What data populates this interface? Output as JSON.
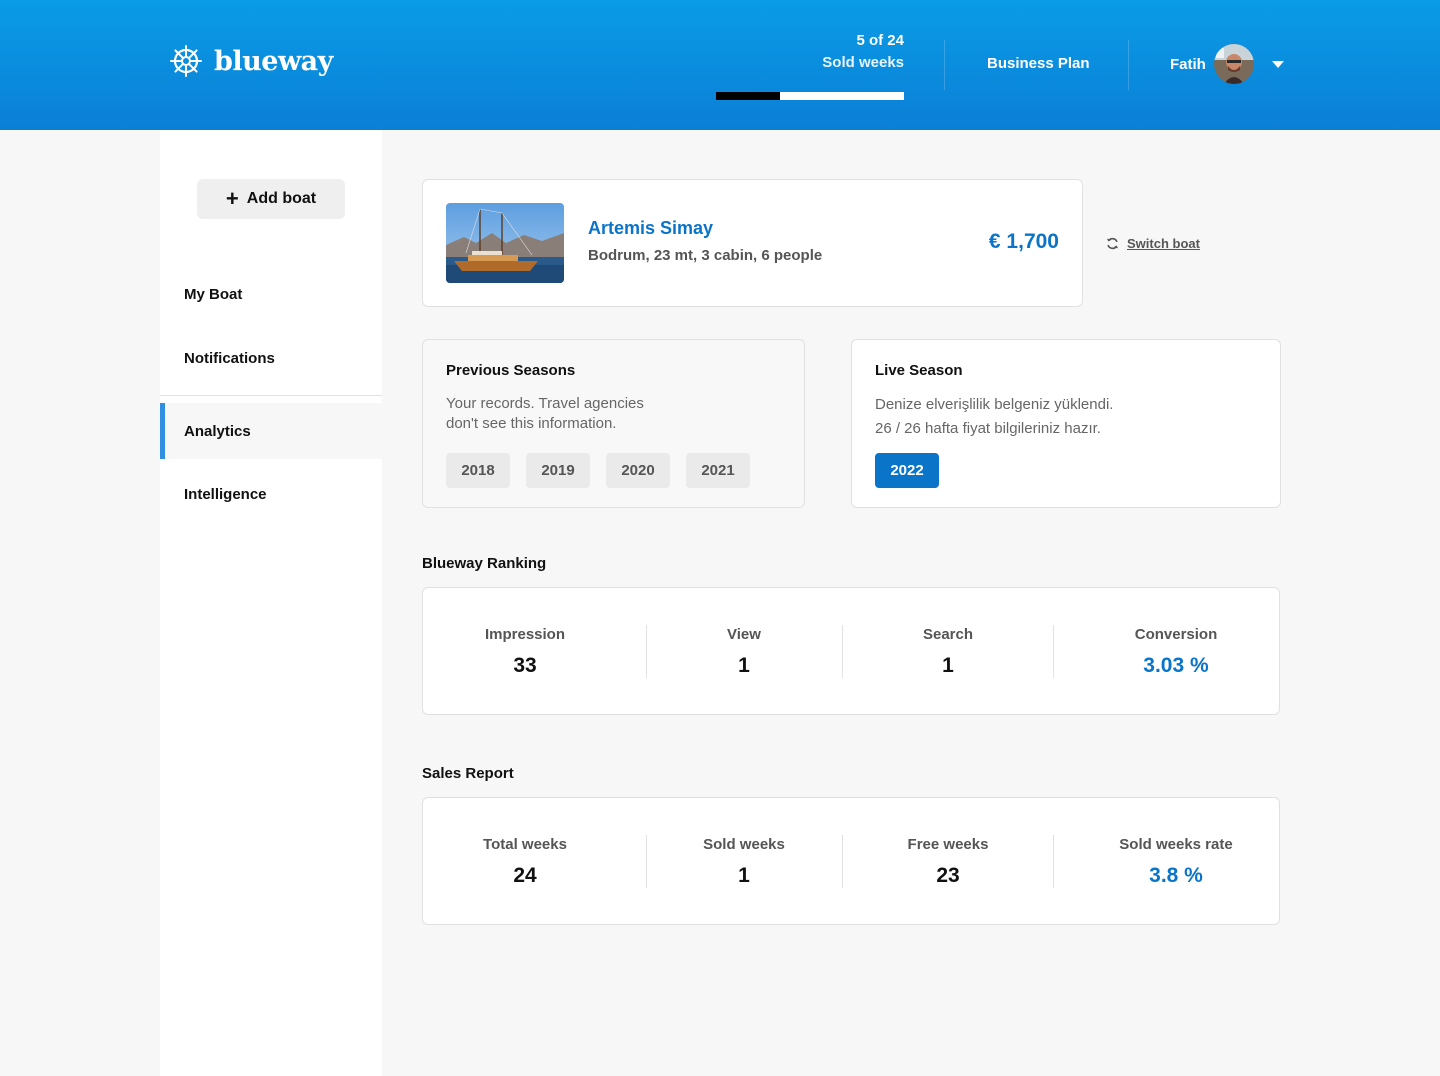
{
  "header": {
    "logo_text": "blueway",
    "sold_count": "5 of 24",
    "sold_label": "Sold weeks",
    "sold_progress": 0.34,
    "business_plan": "Business Plan",
    "user_name": "Fatih"
  },
  "sidebar": {
    "add_boat": "Add boat",
    "items": [
      {
        "label": "My Boat"
      },
      {
        "label": "Notifications"
      },
      {
        "label": "Analytics"
      },
      {
        "label": "Intelligence"
      }
    ],
    "active_item": "Analytics"
  },
  "boat": {
    "name": "Artemis Simay",
    "description": "Bodrum, 23 mt, 3 cabin, 6 people",
    "price": "€ 1,700",
    "switch_label": "Switch boat"
  },
  "previous_seasons": {
    "title": "Previous Seasons",
    "line1": "Your records. Travel agencies",
    "line2": "don't see this information.",
    "years": [
      "2018",
      "2019",
      "2020",
      "2021"
    ]
  },
  "live_season": {
    "title": "Live Season",
    "line1": "Denize elverişlilik belgeniz yüklendi.",
    "line2": "26 / 26 hafta fiyat bilgileriniz hazır.",
    "year": "2022"
  },
  "ranking": {
    "title": "Blueway Ranking",
    "stats": [
      {
        "label": "Impression",
        "value": "33"
      },
      {
        "label": "View",
        "value": "1"
      },
      {
        "label": "Search",
        "value": "1"
      },
      {
        "label": "Conversion",
        "value": "3.03 %"
      }
    ]
  },
  "sales": {
    "title": "Sales Report",
    "stats": [
      {
        "label": "Total weeks",
        "value": "24"
      },
      {
        "label": "Sold weeks",
        "value": "1"
      },
      {
        "label": "Free weeks",
        "value": "23"
      },
      {
        "label": "Sold weeks rate",
        "value": "3.8 %"
      }
    ]
  },
  "colors": {
    "accent": "#0a74c9",
    "header_top": "#0a9ce6",
    "header_bottom": "#0b7fd6",
    "active_bar": "#2f8fe0"
  },
  "icons": {
    "logo": "ship-wheel-icon",
    "add": "plus-icon",
    "switch": "refresh-icon",
    "menu": "chevron-down-icon"
  }
}
